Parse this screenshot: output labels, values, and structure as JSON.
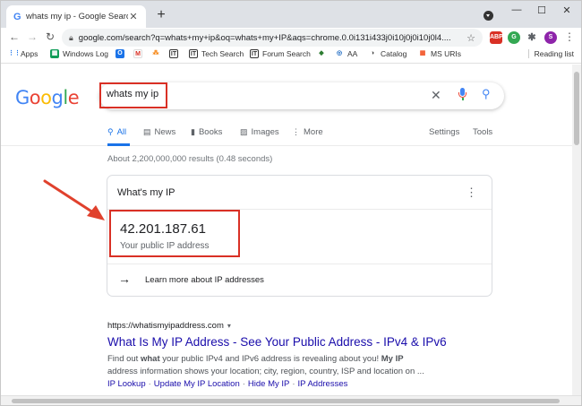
{
  "tab": {
    "title": "whats my ip - Google Search",
    "close": "✕"
  },
  "new_tab": "+",
  "window_controls": {
    "minimize": "—",
    "maximize": "☐",
    "close": "✕"
  },
  "nav": {
    "back": "←",
    "forward": "→",
    "reload": "↻"
  },
  "address": {
    "url": "google.com/search?q=whats+my+ip&oq=whats+my+IP&aqs=chrome.0.0i131i433j0i10j0j0i10j0l4....",
    "star": "☆"
  },
  "extensions": [
    {
      "label": "ABP",
      "color": "#d93025"
    },
    {
      "label": "G",
      "color": "#34a853"
    },
    {
      "label": "✱",
      "color": "#5f6368"
    },
    {
      "label": "S",
      "color": "#8e24aa"
    }
  ],
  "menu": "⋮",
  "bookmarks": [
    {
      "label": "Apps",
      "color": "#4285f4"
    },
    {
      "label": "Windows Log",
      "color": "#0f9d58"
    },
    {
      "label": "",
      "color": "#1a73e8"
    },
    {
      "label": "",
      "color": "#d93025"
    },
    {
      "label": "",
      "color": "#f57c00"
    },
    {
      "label": "",
      "color": "#333333"
    },
    {
      "label": "Tech Search",
      "color": "#333333"
    },
    {
      "label": "Forum Search",
      "color": "#333333"
    },
    {
      "label": "",
      "color": "#2e7d32"
    },
    {
      "label": "AA",
      "color": "#1565c0"
    },
    {
      "label": "Catalog",
      "color": "#424242"
    },
    {
      "label": "MS URIs",
      "color": "#f25022"
    }
  ],
  "bookmark_icons": [
    "⋮⋮",
    "▦",
    "O",
    "M",
    "⁂",
    "IT",
    "IT",
    "IT",
    "◆",
    "◎",
    "◑",
    "▦"
  ],
  "reading_list": "Reading list",
  "logo": {
    "letters": [
      "G",
      "o",
      "o",
      "g",
      "l",
      "e"
    ],
    "colors": [
      "#4285f4",
      "#ea4335",
      "#fbbc05",
      "#4285f4",
      "#34a853",
      "#ea4335"
    ]
  },
  "search": {
    "query": "whats my ip",
    "clear": "✕",
    "search_glyph": "⚲"
  },
  "result_tabs": [
    {
      "label": "All",
      "icon": "⚲"
    },
    {
      "label": "News",
      "icon": "▤"
    },
    {
      "label": "Books",
      "icon": "▮"
    },
    {
      "label": "Images",
      "icon": "▨"
    },
    {
      "label": "More",
      "icon": "⋮"
    }
  ],
  "right_tabs": {
    "settings": "Settings",
    "tools": "Tools"
  },
  "stats": "About 2,200,000,000 results (0.48 seconds)",
  "card": {
    "heading": "What's my IP",
    "menu": "⋮",
    "ip": "42.201.187.61",
    "ip_label": "Your public IP address",
    "learn_more": "Learn more about IP addresses",
    "arrow": "→"
  },
  "result": {
    "cite": "https://whatismyipaddress.com",
    "caret": "▾",
    "title": "What Is My IP Address - See Your Public Address - IPv4 & IPv6",
    "snippet_parts": [
      "Find out ",
      "what",
      " your public IPv4 and IPv6 address is revealing about you! ",
      "My IP",
      " address information shows your location; city, region, country, ISP and location on ..."
    ],
    "sitelinks": [
      "IP Lookup",
      "Update My IP Location",
      "Hide My IP",
      "IP Addresses"
    ],
    "sitelink_sep": "·"
  },
  "colors": {
    "highlight": "#d93025",
    "link": "#1a0dab",
    "accent": "#1a73e8"
  }
}
